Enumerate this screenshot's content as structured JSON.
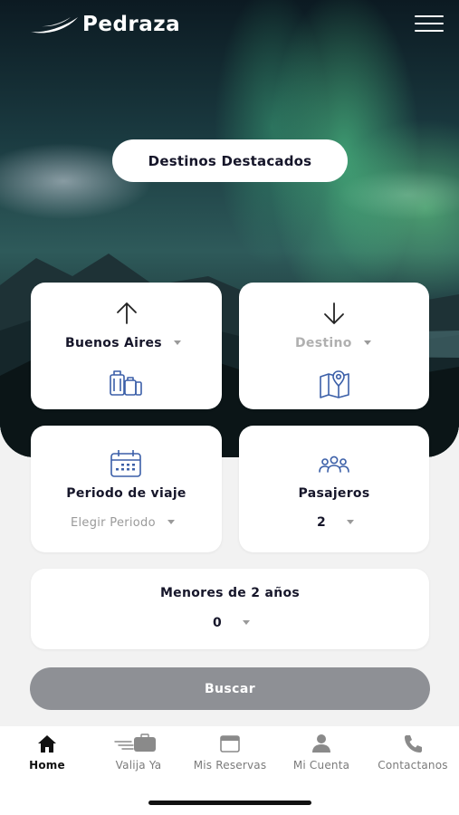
{
  "brand": {
    "name": "Pedraza"
  },
  "hero": {
    "featured_label": "Destinos Destacados"
  },
  "origin": {
    "value": "Buenos Aires"
  },
  "destination": {
    "placeholder": "Destino"
  },
  "period": {
    "title": "Periodo de viaje",
    "placeholder": "Elegir Periodo"
  },
  "passengers": {
    "title": "Pasajeros",
    "value": "2"
  },
  "minors": {
    "title": "Menores de 2 años",
    "value": "0"
  },
  "search": {
    "label": "Buscar"
  },
  "tabs": [
    {
      "label": "Home",
      "icon": "home-icon",
      "active": true
    },
    {
      "label": "Valija Ya",
      "icon": "suitcase-icon",
      "active": false
    },
    {
      "label": "Mis Reservas",
      "icon": "calendar-icon",
      "active": false
    },
    {
      "label": "Mi Cuenta",
      "icon": "user-icon",
      "active": false
    },
    {
      "label": "Contactanos",
      "icon": "phone-icon",
      "active": false
    }
  ],
  "colors": {
    "accent_blue": "#3b5fa8",
    "navy_text": "#16162a",
    "search_button": "#8e9095",
    "background": "#f2f2f2"
  }
}
